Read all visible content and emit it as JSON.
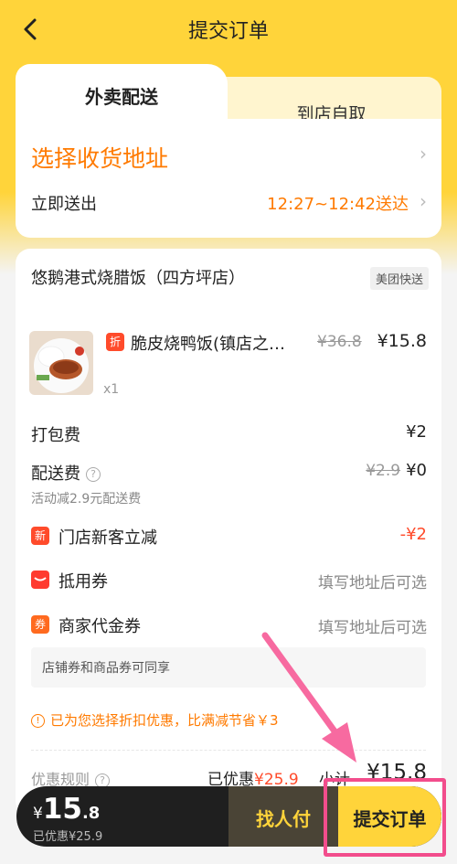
{
  "header": {
    "title": "提交订单"
  },
  "tabs": {
    "delivery": "外卖配送",
    "pickup": "到店自取"
  },
  "address": {
    "prompt": "选择收货地址",
    "deliver_label": "立即送出",
    "deliver_time": "12:27~12:42送达"
  },
  "shop": {
    "name": "悠鹅港式烧腊饭（四方坪店）",
    "badge": "美团快送"
  },
  "item": {
    "discount_badge": "折",
    "name": "脆皮烧鸭饭(镇店之…",
    "orig_price": "¥36.8",
    "price": "¥15.8",
    "qty": "x1"
  },
  "fees": {
    "packing_label": "打包费",
    "packing_value": "¥2",
    "delivery_label": "配送费",
    "delivery_orig": "¥2.9",
    "delivery_value": "¥0",
    "delivery_note": "活动减2.9元配送费"
  },
  "promos": [
    {
      "badge": "新",
      "label": "门店新客立减",
      "value": "-¥2",
      "color": "#ff4b2b"
    },
    {
      "badge": "",
      "label": "抵用券",
      "value": "填写地址后可选",
      "color": "#ff3b30"
    },
    {
      "badge": "券",
      "label": "商家代金券",
      "value": "填写地址后可选",
      "color": "#ff6a1f"
    }
  ],
  "share_note": "店铺券和商品券可同享",
  "discount_tip": "已为您选择折扣优惠，比满减节省￥3",
  "summary": {
    "rule_label": "优惠规则",
    "saved_prefix": "已优惠",
    "saved_value": "¥25.9",
    "subtotal_label": "小计",
    "subtotal_value": "¥15.8"
  },
  "bottom_bar": {
    "yen": "¥",
    "price_int": "15",
    "price_dec": ".8",
    "saved": "已优惠¥25.9",
    "pay_button": "找人付",
    "submit_button": "提交订单"
  },
  "colors": {
    "brand_yellow": "#ffd43a",
    "accent_orange": "#ff7a00",
    "discount_red": "#ff4b2b",
    "annotation_pink": "#f24d8c"
  }
}
